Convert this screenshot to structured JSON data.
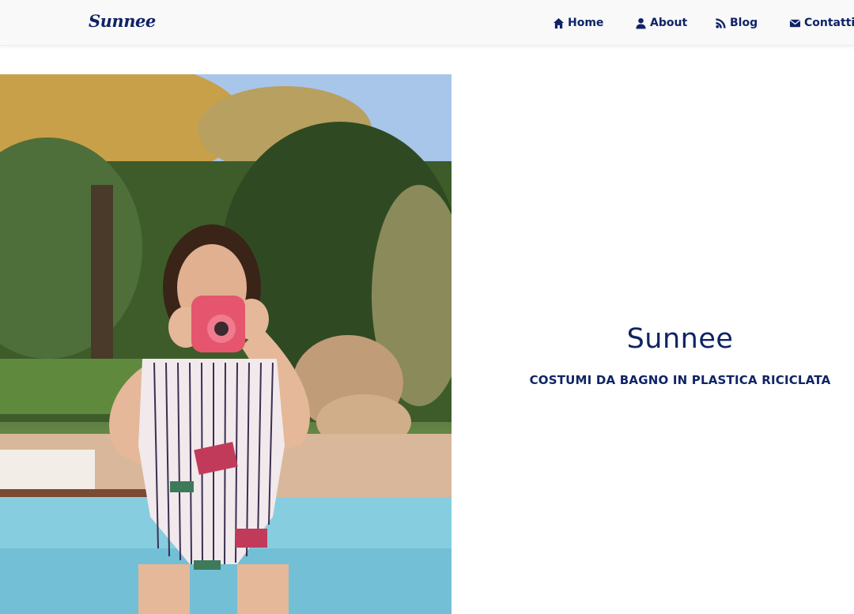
{
  "header": {
    "brand": "Sunnee",
    "nav": [
      {
        "label": "Home",
        "icon": "home-icon"
      },
      {
        "label": "About",
        "icon": "user-icon"
      },
      {
        "label": "Blog",
        "icon": "rss-icon"
      },
      {
        "label": "Contatti",
        "icon": "envelope-icon"
      }
    ]
  },
  "hero": {
    "title": "Sunnee",
    "subtitle": "COSTUMI DA BAGNO IN PLASTICA RICICLATA"
  },
  "colors": {
    "primary": "#0f2466",
    "navbar_bg": "#f9f9f9"
  }
}
